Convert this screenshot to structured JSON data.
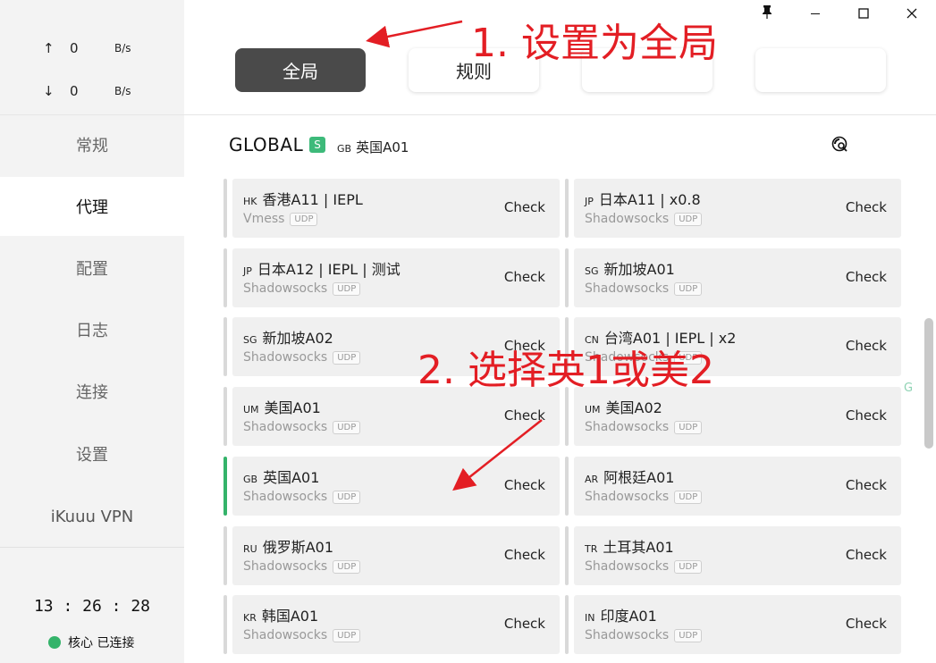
{
  "window": {
    "pin_icon": "pin-icon",
    "minimize_icon": "minimize-icon",
    "maximize_icon": "maximize-icon",
    "close_icon": "close-icon"
  },
  "traffic": {
    "up_arrow": "↑",
    "up_value": "0",
    "up_unit": "B/s",
    "down_arrow": "↓",
    "down_value": "0",
    "down_unit": "B/s"
  },
  "sidebar": {
    "items": [
      {
        "label": "常规"
      },
      {
        "label": "代理"
      },
      {
        "label": "配置"
      },
      {
        "label": "日志"
      },
      {
        "label": "连接"
      },
      {
        "label": "设置"
      },
      {
        "label": "iKuuu VPN"
      }
    ],
    "active": "代理"
  },
  "footer": {
    "clock": "13 : 26 : 28",
    "status": "核心 已连接",
    "status_color": "#34b36a"
  },
  "modes": {
    "global": "全局",
    "rule": "规则",
    "blank1": "",
    "blank2": "",
    "active": "全局"
  },
  "group": {
    "title": "GLOBAL",
    "badge": "S",
    "selected_cc": "GB",
    "selected_name": "英国A01"
  },
  "proxies": [
    {
      "cc": "HK",
      "name": "香港A11 | IEPL",
      "type": "Vmess",
      "udp": "UDP",
      "action": "Check"
    },
    {
      "cc": "JP",
      "name": "日本A11 | x0.8",
      "type": "Shadowsocks",
      "udp": "UDP",
      "action": "Check"
    },
    {
      "cc": "JP",
      "name": "日本A12 | IEPL | 测试",
      "type": "Shadowsocks",
      "udp": "UDP",
      "action": "Check"
    },
    {
      "cc": "SG",
      "name": "新加坡A01",
      "type": "Shadowsocks",
      "udp": "UDP",
      "action": "Check"
    },
    {
      "cc": "SG",
      "name": "新加坡A02",
      "type": "Shadowsocks",
      "udp": "UDP",
      "action": "Check"
    },
    {
      "cc": "CN",
      "name": "台湾A01 | IEPL | x2",
      "type": "Shadowsocks",
      "udp": "UDP",
      "action": "Check"
    },
    {
      "cc": "UM",
      "name": "美国A01",
      "type": "Shadowsocks",
      "udp": "UDP",
      "action": "Check"
    },
    {
      "cc": "UM",
      "name": "美国A02",
      "type": "Shadowsocks",
      "udp": "UDP",
      "action": "Check"
    },
    {
      "cc": "GB",
      "name": "英国A01",
      "type": "Shadowsocks",
      "udp": "UDP",
      "action": "Check"
    },
    {
      "cc": "AR",
      "name": "阿根廷A01",
      "type": "Shadowsocks",
      "udp": "UDP",
      "action": "Check"
    },
    {
      "cc": "RU",
      "name": "俄罗斯A01",
      "type": "Shadowsocks",
      "udp": "UDP",
      "action": "Check"
    },
    {
      "cc": "TR",
      "name": "土耳其A01",
      "type": "Shadowsocks",
      "udp": "UDP",
      "action": "Check"
    },
    {
      "cc": "KR",
      "name": "韩国A01",
      "type": "Shadowsocks",
      "udp": "UDP",
      "action": "Check"
    },
    {
      "cc": "IN",
      "name": "印度A01",
      "type": "Shadowsocks",
      "udp": "UDP",
      "action": "Check"
    }
  ],
  "selected_proxy": "英国A01",
  "side_mark": "G",
  "annotations": {
    "step1": "1. 设置为全局",
    "step2": "2. 选择英1或美2",
    "color": "#e31e24"
  }
}
